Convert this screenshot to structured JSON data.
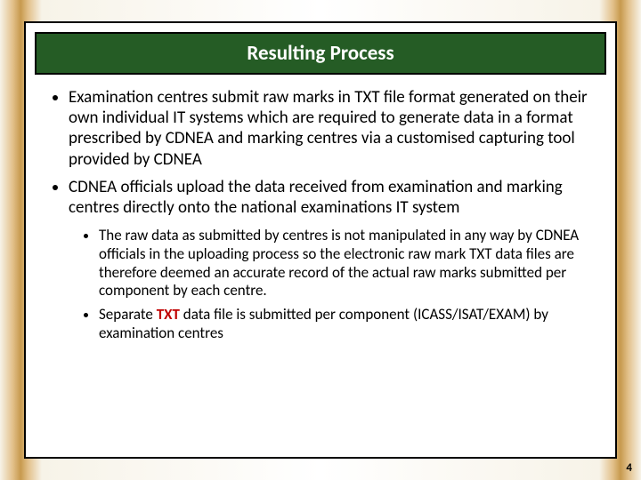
{
  "title": "Resulting Process",
  "bullets": {
    "b1": "Examination centres submit raw marks in TXT file format generated on their own individual IT systems which are required to generate data in a format prescribed by CDNEA and marking centres via a customised capturing tool provided by CDNEA",
    "b2": "CDNEA officials upload the data received from examination and marking centres directly onto the national examinations IT system",
    "s1": "The raw data as submitted by centres is not manipulated in any way by CDNEA officials in the uploading process so the electronic raw mark TXT data files are therefore deemed an accurate record of the actual raw marks submitted per component by each centre.",
    "s2a": "Separate ",
    "s2_hl": "TXT",
    "s2b": " data file is submitted per component (ICASS/ISAT/EXAM) by examination centres"
  },
  "page_number": "4"
}
